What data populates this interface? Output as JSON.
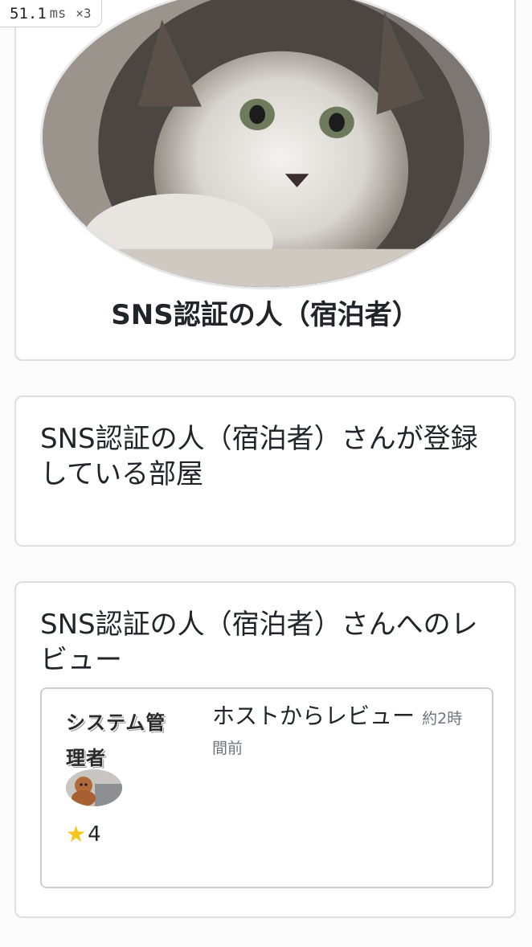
{
  "perf": {
    "value": "51.1",
    "unit": "ms",
    "multiplier": "×3"
  },
  "profile": {
    "name": "SNS認証の人（宿泊者）"
  },
  "rooms": {
    "title": "SNS認証の人（宿泊者）さんが登録している部屋"
  },
  "reviews": {
    "title": "SNS認証の人（宿泊者）さんへのレビュー",
    "items": [
      {
        "reviewer": "システム管理者",
        "rating": "4",
        "title": "ホストからレビュー",
        "time": "約2時間前"
      }
    ]
  },
  "colors": {
    "star": "#f5c518",
    "border": "#dedede",
    "muted": "#6c757d"
  },
  "icons": {
    "rating": "star-icon"
  }
}
